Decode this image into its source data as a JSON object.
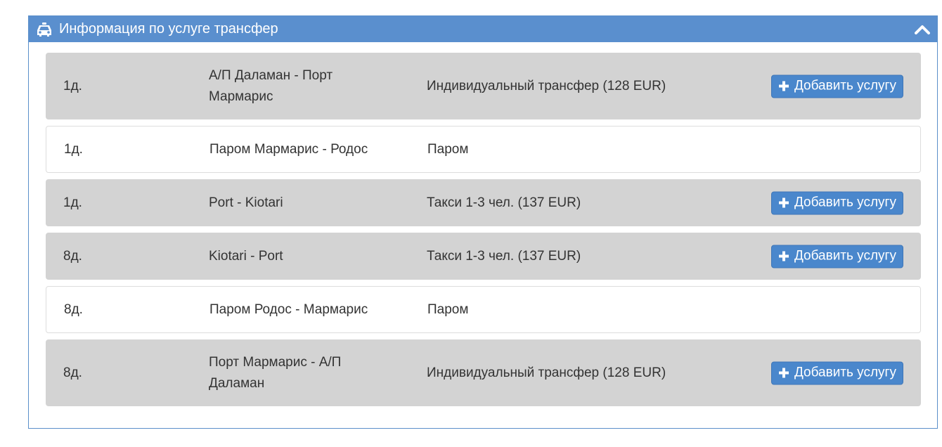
{
  "panel": {
    "title": "Информация по услуге трансфер",
    "header_icon": "car-icon",
    "collapse_icon": "chevron-up-icon",
    "accent_color": "#5a8fce"
  },
  "add_button_label": "Добавить услугу",
  "rows": [
    {
      "day": "1д.",
      "route": "А/П Даламан - Порт Мармарис",
      "service": "Индивидуальный трансфер (128 EUR)",
      "has_button": true
    },
    {
      "day": "1д.",
      "route": "Паром Мармарис - Родос",
      "service": "Паром",
      "has_button": false
    },
    {
      "day": "1д.",
      "route": "Port - Kiotari",
      "service": "Такси 1-3 чел. (137 EUR)",
      "has_button": true
    },
    {
      "day": "8д.",
      "route": "Kiotari - Port",
      "service": "Такси 1-3 чел. (137 EUR)",
      "has_button": true
    },
    {
      "day": "8д.",
      "route": "Паром Родос - Мармарис",
      "service": "Паром",
      "has_button": false
    },
    {
      "day": "8д.",
      "route": "Порт Мармарис - А/П Даламан",
      "service": "Индивидуальный трансфер (128 EUR)",
      "has_button": true
    }
  ]
}
